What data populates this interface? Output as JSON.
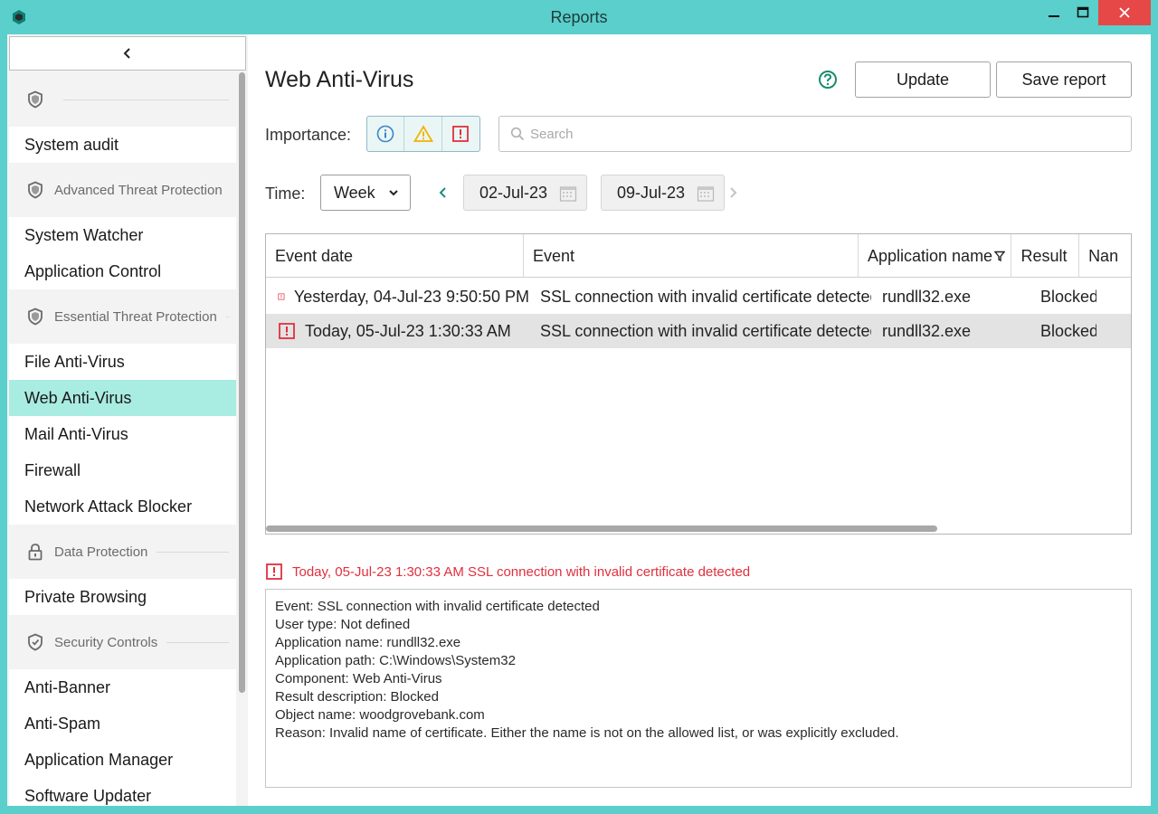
{
  "window": {
    "title": "Reports"
  },
  "sidebar": {
    "groups": [
      {
        "type": "section",
        "label": "",
        "icon": "shield-icon"
      },
      {
        "type": "item",
        "label": "System audit"
      },
      {
        "type": "section",
        "label": "Advanced Threat Protection",
        "icon": "shield-icon"
      },
      {
        "type": "item",
        "label": "System Watcher"
      },
      {
        "type": "item",
        "label": "Application Control"
      },
      {
        "type": "section",
        "label": "Essential Threat Protection",
        "icon": "shield-icon"
      },
      {
        "type": "item",
        "label": "File Anti-Virus"
      },
      {
        "type": "item",
        "label": "Web Anti-Virus",
        "active": true
      },
      {
        "type": "item",
        "label": "Mail Anti-Virus"
      },
      {
        "type": "item",
        "label": "Firewall"
      },
      {
        "type": "item",
        "label": "Network Attack Blocker"
      },
      {
        "type": "section",
        "label": "Data Protection",
        "icon": "lock-icon"
      },
      {
        "type": "item",
        "label": "Private Browsing"
      },
      {
        "type": "section",
        "label": "Security Controls",
        "icon": "shield-check-icon"
      },
      {
        "type": "item",
        "label": "Anti-Banner"
      },
      {
        "type": "item",
        "label": "Anti-Spam"
      },
      {
        "type": "item",
        "label": "Application Manager"
      },
      {
        "type": "item",
        "label": "Software Updater"
      }
    ]
  },
  "main": {
    "title": "Web Anti-Virus",
    "update_label": "Update",
    "save_label": "Save report",
    "importance_label": "Importance:",
    "search_placeholder": "Search",
    "time_label": "Time:",
    "period": "Week",
    "date_from": "02-Jul-23",
    "date_to": "09-Jul-23"
  },
  "table": {
    "columns": [
      "Event date",
      "Event",
      "Application name",
      "Result",
      "Nan"
    ],
    "rows": [
      {
        "date": "Yesterday, 04-Jul-23 9:50:50 PM",
        "event": "SSL connection with invalid certificate detected",
        "app": "rundll32.exe",
        "result": "Blocked",
        "severity": "critical"
      },
      {
        "date": "Today, 05-Jul-23 1:30:33 AM",
        "event": "SSL connection with invalid certificate detected",
        "app": "rundll32.exe",
        "result": "Blocked",
        "severity": "critical",
        "selected": true
      }
    ]
  },
  "detail": {
    "heading": "Today, 05-Jul-23 1:30:33 AM SSL connection with invalid certificate detected",
    "lines": [
      "Event: SSL connection with invalid certificate detected",
      "User type: Not defined",
      "Application name: rundll32.exe",
      "Application path: C:\\Windows\\System32",
      "Component: Web Anti-Virus",
      "Result description: Blocked",
      "Object name: woodgrovebank.com",
      "Reason: Invalid name of certificate. Either the name is not on the allowed list, or was explicitly excluded."
    ]
  },
  "colors": {
    "accent": "#5bcfcb",
    "active_item": "#a9ece2",
    "critical": "#e0303d",
    "warning": "#f0b400",
    "info": "#3a86c8"
  }
}
